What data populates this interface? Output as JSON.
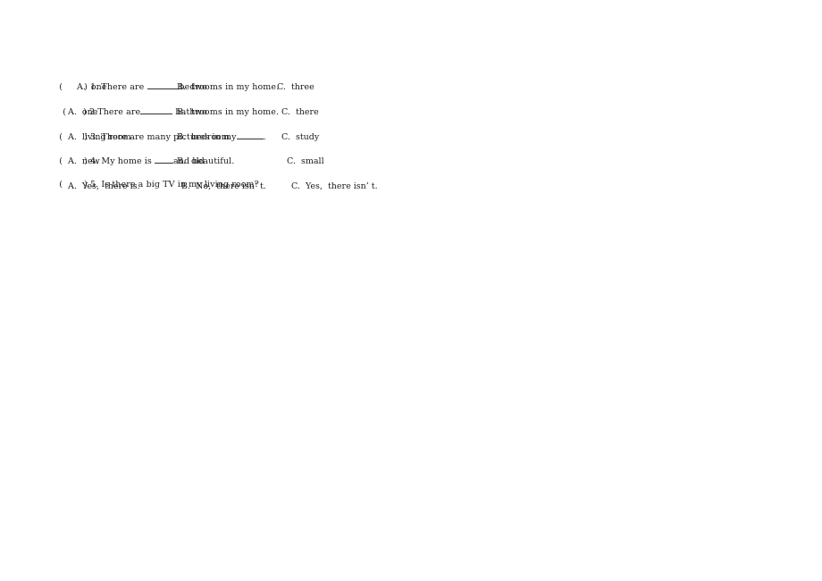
{
  "questions": [
    {
      "number": "1.",
      "prefix": "There are ",
      "suffix": "bedrooms in my home.",
      "options": [
        "A.  one",
        "B.  two",
        "C.  three"
      ]
    },
    {
      "number": "2.",
      "prefix": "There are",
      "suffix": " bathrooms in my home.",
      "options": [
        "A.  one",
        "B.  two",
        "C.  there"
      ]
    },
    {
      "number": "3.",
      "prefix": "There are many pictures in my",
      "suffix": ".",
      "options": [
        "A.  living room",
        "B.  bedroom",
        "C.  study"
      ]
    },
    {
      "number": "4.",
      "prefix": "My home is ",
      "suffix": "and beautiful.",
      "options": [
        "A.  new",
        "B.  old",
        "C.  small"
      ]
    },
    {
      "number": "5.",
      "prefix": "Is there a big TV in my living room?",
      "suffix": "",
      "options": [
        "A.  Yes,  there is.",
        "B.  No,  there isn’ t.",
        "C.  Yes,  there isn’ t."
      ]
    }
  ],
  "paren_open": "(",
  "paren_close": ")"
}
